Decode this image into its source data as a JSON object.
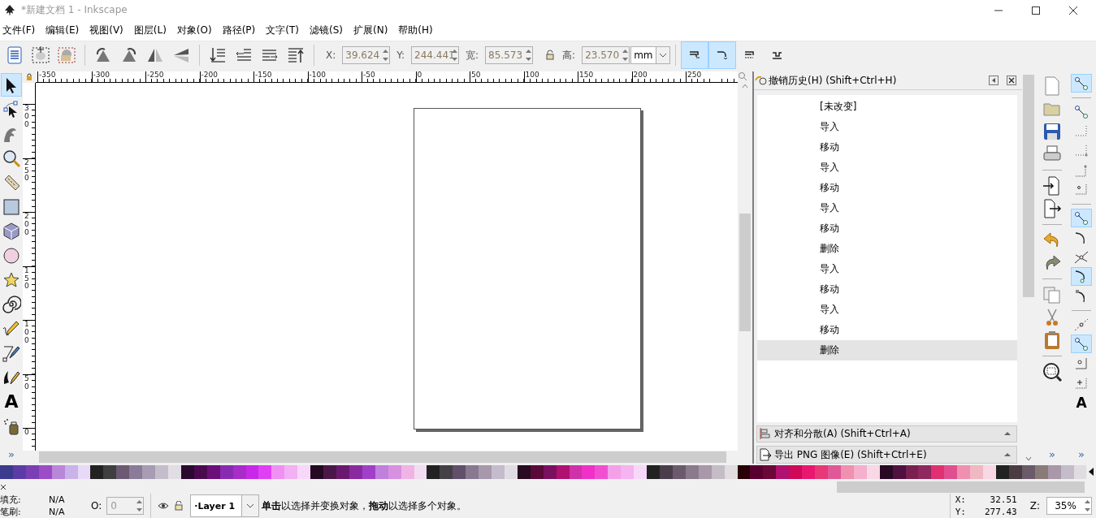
{
  "window": {
    "title": "*新建文档 1 - Inkscape"
  },
  "menu": [
    "文件(F)",
    "编辑(E)",
    "视图(V)",
    "图层(L)",
    "对象(O)",
    "路径(P)",
    "文字(T)",
    "滤镜(S)",
    "扩展(N)",
    "帮助(H)"
  ],
  "toolbar": {
    "fields": [
      {
        "label": "X:",
        "value": "39.624"
      },
      {
        "label": "Y:",
        "value": "244.441"
      },
      {
        "label": "宽:",
        "value": "85.573"
      },
      {
        "label": "高:",
        "value": "23.570"
      }
    ],
    "unit": "mm",
    "toggles": [
      {
        "selected": true
      },
      {
        "selected": true
      },
      {
        "selected": false
      },
      {
        "selected": false
      }
    ]
  },
  "tools": {
    "items": [
      {
        "kind": "select",
        "selected": true
      },
      {
        "kind": "node",
        "selected": false
      },
      {
        "kind": "tweak",
        "selected": false
      },
      {
        "kind": "zoom",
        "selected": false
      },
      {
        "kind": "measure",
        "selected": false
      },
      {
        "kind": "rect",
        "selected": false
      },
      {
        "kind": "box3d",
        "selected": false
      },
      {
        "kind": "ellipse",
        "selected": false
      },
      {
        "kind": "star",
        "selected": false
      },
      {
        "kind": "spiral",
        "selected": false
      },
      {
        "kind": "pencil",
        "selected": false
      },
      {
        "kind": "pen",
        "selected": false
      },
      {
        "kind": "calligraphy",
        "selected": false
      },
      {
        "kind": "text",
        "selected": false,
        "glyph": "A"
      },
      {
        "kind": "spray",
        "selected": false
      }
    ],
    "more": "»"
  },
  "rulers": {
    "horizontal": [
      "-350",
      "-300",
      "-250",
      "-200",
      "-150",
      "-100",
      "-50",
      "0",
      "50",
      "100",
      "150",
      "200",
      "250"
    ],
    "vertical": [
      "300",
      "250",
      "200",
      "150",
      "100",
      "50",
      "0"
    ]
  },
  "history": {
    "title": "撤销历史(H) (Shift+Ctrl+H)",
    "items": [
      {
        "label": "[未改变]",
        "selected": false
      },
      {
        "label": "导入",
        "selected": false
      },
      {
        "label": "移动",
        "selected": false
      },
      {
        "label": "导入",
        "selected": false
      },
      {
        "label": "移动",
        "selected": false
      },
      {
        "label": "导入",
        "selected": false
      },
      {
        "label": "移动",
        "selected": false
      },
      {
        "label": "删除",
        "selected": false
      },
      {
        "label": "导入",
        "selected": false
      },
      {
        "label": "移动",
        "selected": false
      },
      {
        "label": "导入",
        "selected": false
      },
      {
        "label": "移动",
        "selected": false
      },
      {
        "label": "删除",
        "selected": true
      }
    ]
  },
  "panels": [
    {
      "kind": "align",
      "title": "对齐和分散(A) (Shift+Ctrl+A)"
    },
    {
      "kind": "export",
      "title": "导出 PNG 图像(E) (Shift+Ctrl+E)"
    }
  ],
  "commands": {
    "more": "»"
  },
  "snaps": {
    "items": [
      {
        "selected": true
      },
      {
        "selected": false
      },
      {
        "selected": false
      },
      {
        "selected": false
      },
      {
        "selected": false
      },
      {
        "selected": false
      },
      {
        "selected": true
      },
      {
        "selected": false
      },
      {
        "selected": false
      },
      {
        "selected": true
      },
      {
        "selected": false
      },
      {
        "selected": false
      },
      {
        "selected": true
      },
      {
        "selected": false
      },
      {
        "selected": false
      },
      {
        "selected": false,
        "glyph": "A"
      }
    ],
    "more": "»"
  },
  "palette": [
    {
      "color": "#3b3a8c"
    },
    {
      "color": "#5b3ca6"
    },
    {
      "color": "#7a3fb4"
    },
    {
      "color": "#9b4cc6"
    },
    {
      "color": "#b987da"
    },
    {
      "color": "#c9b3e8"
    },
    {
      "color": "#e8daf6"
    },
    {
      "color": "#222222"
    },
    {
      "color": "#3f3f3f"
    },
    {
      "color": "#6b5a72"
    },
    {
      "color": "#8a7c98"
    },
    {
      "color": "#a89cb4"
    },
    {
      "color": "#c4bdcc"
    },
    {
      "color": "#e1dde4"
    },
    {
      "color": "#2a0a2e"
    },
    {
      "color": "#4a0a50"
    },
    {
      "color": "#6a1078"
    },
    {
      "color": "#8a2ab0"
    },
    {
      "color": "#a82cc8"
    },
    {
      "color": "#c828e8"
    },
    {
      "color": "#e040f4"
    },
    {
      "color": "#f090f4"
    },
    {
      "color": "#f3b0f3"
    },
    {
      "color": "#f8d8f8"
    },
    {
      "color": "#240a22"
    },
    {
      "color": "#4a1848"
    },
    {
      "color": "#6a1a6e"
    },
    {
      "color": "#8a2aa0"
    },
    {
      "color": "#a040c8"
    },
    {
      "color": "#c080dc"
    },
    {
      "color": "#d890e0"
    },
    {
      "color": "#efb4e4"
    },
    {
      "color": "#f2dcf2"
    },
    {
      "color": "#222222"
    },
    {
      "color": "#444046"
    },
    {
      "color": "#60506a"
    },
    {
      "color": "#887890"
    },
    {
      "color": "#a898ac"
    },
    {
      "color": "#c4bccc"
    },
    {
      "color": "#e0dce4"
    },
    {
      "color": "#280a22"
    },
    {
      "color": "#5a0a38"
    },
    {
      "color": "#7a1060"
    },
    {
      "color": "#b01070"
    },
    {
      "color": "#d030a8"
    },
    {
      "color": "#f030c8"
    },
    {
      "color": "#f050d0"
    },
    {
      "color": "#f4a0e8"
    },
    {
      "color": "#f4b4f0"
    },
    {
      "color": "#f8d8f8"
    },
    {
      "color": "#222222"
    },
    {
      "color": "#4a3e4a"
    },
    {
      "color": "#6a5a6c"
    },
    {
      "color": "#8a7a8c"
    },
    {
      "color": "#a898a8"
    },
    {
      "color": "#c4bcc6"
    },
    {
      "color": "#e0dce0"
    },
    {
      "color": "#280008"
    },
    {
      "color": "#5a0030"
    },
    {
      "color": "#6a0838"
    },
    {
      "color": "#b01070"
    },
    {
      "color": "#d00858"
    },
    {
      "color": "#e81870"
    },
    {
      "color": "#e83878"
    },
    {
      "color": "#e05898"
    },
    {
      "color": "#f090b0"
    },
    {
      "color": "#f4b0cc"
    },
    {
      "color": "#f8d8e4"
    },
    {
      "color": "#280a24"
    },
    {
      "color": "#501040"
    },
    {
      "color": "#7a2050"
    },
    {
      "color": "#902860"
    },
    {
      "color": "#e03070"
    },
    {
      "color": "#e05090"
    },
    {
      "color": "#f090b0"
    },
    {
      "color": "#f0b8c0"
    },
    {
      "color": "#f8d8e4"
    },
    {
      "color": "#222222"
    },
    {
      "color": "#4a3c42"
    },
    {
      "color": "#6a5a6a"
    },
    {
      "color": "#8a7a78"
    },
    {
      "color": "#a898a8"
    },
    {
      "color": "#c4bcc8"
    },
    {
      "color": "#e0dce0"
    }
  ],
  "status": {
    "fill_stroke": [
      {
        "label": "填充:",
        "value": "N/A"
      },
      {
        "label": "笔刷:",
        "value": "N/A"
      }
    ],
    "opacity": {
      "label": "O:",
      "value": "0",
      "disabled": true
    },
    "layer": "·Layer 1",
    "message": "**单击**以选择并变换对象，**拖动**以选择多个对象。",
    "cursor": [
      {
        "label": "X:",
        "value": "32.51"
      },
      {
        "label": "Y:",
        "value": "277.43"
      }
    ],
    "zoom": {
      "label": "Z:",
      "value": "35%"
    }
  }
}
